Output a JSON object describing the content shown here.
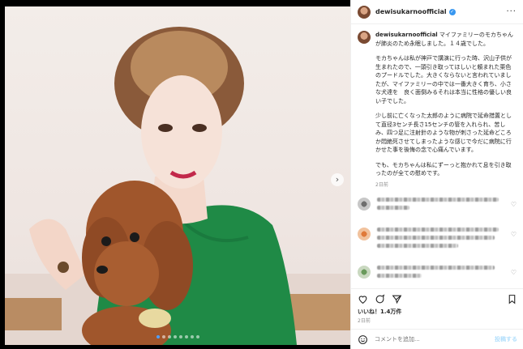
{
  "post": {
    "username": "dewisukarnoofficial",
    "more_icon": "more-options-icon",
    "caption_lines": [
      "マイファミリーのモカちゃんが肺炎のため永眠しました。１４歳でした。",
      "モカちゃんは私が神戸で講演に行った時、沢山子供が生まれたので、一頭引き取ってほしいと頼まれた栗色のプードルでした。大きくならないと言われていましたが、マイファミリーの中では一番大きく育ち、小さな犬達を　良く面倒みるそれは本当に性格の優しい良い子でした。",
      "少し前に亡くなった太郎のように病院で延命措置として直径3センチ長さ15センチの管を入れられ、苦しみ、四つ足に注射針のような物が刺さった延命どころか悶絶死させてしまったような感じで今だに病院に行かせた事を後悔の念で心痛んでいます。",
      "でも、モカちゃんは私にずーっと抱かれて息を引き取ったのが全ての慰めです。"
    ],
    "caption_time": "2日前",
    "likes": "いいね！1.4万件",
    "date": "2日前",
    "comment_placeholder": "コメントを追加...",
    "post_button": "投稿する"
  },
  "colors": {
    "accent": "#3897f0",
    "dress_green": "#1f8a46",
    "dog_brown": "#a0562c"
  }
}
